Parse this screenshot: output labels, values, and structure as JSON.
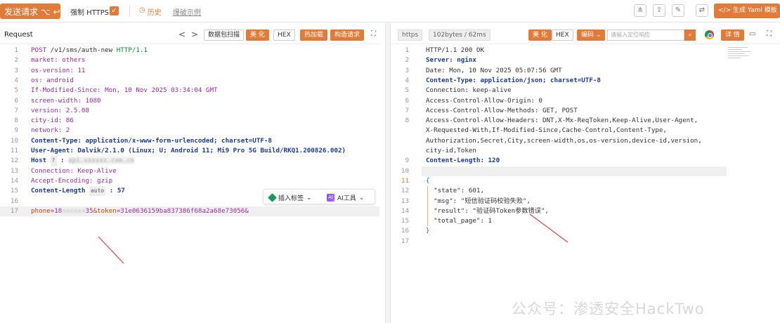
{
  "toolbar": {
    "send_label": "发送请求 ⌥ ↩",
    "force_https_label": "强制 HTTPS",
    "history_label": "历史",
    "demo_label": "爆破示例",
    "yaml_label": "生成 Yaml 模板"
  },
  "request": {
    "title": "Request",
    "nav_prev": "<",
    "nav_next": ">",
    "buttons": [
      "数据包扫描",
      "美 化",
      "HEX",
      "热加载",
      "构造请求"
    ],
    "lines": [
      {
        "n": "1",
        "text": "POST /v1/sms/auth-new HTTP/1.1"
      },
      {
        "n": "2",
        "text": "market: others"
      },
      {
        "n": "3",
        "text": "os-version: 11"
      },
      {
        "n": "4",
        "text": "os: android"
      },
      {
        "n": "5",
        "text": "If-Modified-Since: Mon, 10 Nov 2025 03:34:04 GMT"
      },
      {
        "n": "6",
        "text": "screen-width: 1080"
      },
      {
        "n": "7",
        "text": "version: 2.5.08"
      },
      {
        "n": "8",
        "text": "city-id: 86"
      },
      {
        "n": "9",
        "text": "network: 2"
      },
      {
        "n": "10",
        "text": "Content-Type: application/x-www-form-urlencoded; charset=UTF-8"
      },
      {
        "n": "11",
        "text": "User-Agent: Dalvik/2.1.0 (Linux; U; Android 11; Mi9 Pro 5G Build/RKQ1.200826.002)"
      },
      {
        "n": "12",
        "text": "Host ? : "
      },
      {
        "n": "13",
        "text": "Connection: Keep-Alive"
      },
      {
        "n": "14",
        "text": "Accept-Encoding: gzip"
      },
      {
        "n": "15",
        "text": "Content-Length auto : 57"
      },
      {
        "n": "16",
        "text": ""
      },
      {
        "n": "17",
        "text": "phone=18 35&token=31e0636159ba837386f68a2a68e73056&"
      }
    ],
    "post": "POST",
    "path": " /v1/sms/auth-new ",
    "proto": "HTTP/1.1",
    "auto_pill": "auto",
    "host_pill": "?",
    "body_phone_key": "phone",
    "body_phone_prefix": "=18",
    "body_phone_suffix": "35",
    "body_token_key": "&token",
    "body_token_val": "=31e0636159ba837386f68a2a68e73056&",
    "insert_tag_label": "插入标签",
    "ai_tool_label": "AI工具"
  },
  "response": {
    "protocol_label": "https",
    "size_time": "102bytes / 62ms",
    "buttons": [
      "美 化",
      "HEX",
      "编码"
    ],
    "search_placeholder": "请输入定位响应",
    "details_label": "详 情",
    "lines": [
      {
        "n": "1",
        "text": "HTTP/1.1 200 OK"
      },
      {
        "n": "2",
        "text": "Server: nginx"
      },
      {
        "n": "3",
        "text": "Date: Mon, 10 Nov 2025 05:07:56 GMT"
      },
      {
        "n": "4",
        "text": "Content-Type: application/json; charset=UTF-8"
      },
      {
        "n": "5",
        "text": "Connection: keep-alive"
      },
      {
        "n": "6",
        "text": "Access-Control-Allow-Origin: 0"
      },
      {
        "n": "7",
        "text": "Access-Control-Allow-Methods: GET, POST"
      },
      {
        "n": "8",
        "text": "Access-Control-Allow-Headers: DNT,X-Mx-ReqToken,Keep-Alive,User-Agent,"
      },
      {
        "n": "",
        "text": "X-Requested-With,If-Modified-Since,Cache-Control,Content-Type,"
      },
      {
        "n": "",
        "text": "Authorization,Secret,City,screen-width,os,os-version,device-id,version,"
      },
      {
        "n": "",
        "text": "city-id,Token"
      },
      {
        "n": "9",
        "text": "Content-Length: 120"
      },
      {
        "n": "10",
        "text": ""
      },
      {
        "n": "11",
        "text": "{"
      },
      {
        "n": "12",
        "text": "  \"state\": 601,"
      },
      {
        "n": "13",
        "text": "  \"msg\": \"短信验证码校验失败\","
      },
      {
        "n": "14",
        "text": "  \"result\": \"验证码Token参数错误\","
      },
      {
        "n": "15",
        "text": "  \"total_page\": 1"
      },
      {
        "n": "16",
        "text": "}"
      },
      {
        "n": "17",
        "text": ""
      }
    ]
  },
  "watermark": "公众号：渗透安全HackTwo",
  "colors": {
    "accent": "#e07b39",
    "header_key": "#9b2c9b",
    "bold_header": "#1a3b9a"
  }
}
